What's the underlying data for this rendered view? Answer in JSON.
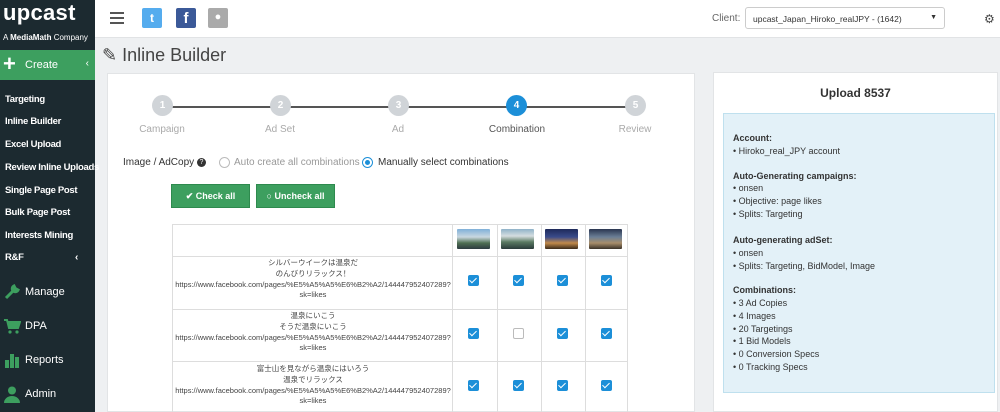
{
  "brand": {
    "logo": "upcast",
    "subtitle_prefix": "A ",
    "subtitle_brand": "MediaMath",
    "subtitle_suffix": " Company"
  },
  "sidebar": {
    "create_label": "Create",
    "sub_items": [
      {
        "label": "Targeting"
      },
      {
        "label": "Inline Builder"
      },
      {
        "label": "Excel Upload"
      },
      {
        "label": "Review Inline Uploads"
      },
      {
        "label": "Single Page Post"
      },
      {
        "label": "Bulk Page Post"
      },
      {
        "label": "Interests Mining"
      },
      {
        "label": "R&F"
      }
    ],
    "main_items": [
      {
        "label": "Manage",
        "icon": "wrench-icon"
      },
      {
        "label": "DPA",
        "icon": "cart-icon"
      },
      {
        "label": "Reports",
        "icon": "bar-chart-icon"
      },
      {
        "label": "Admin",
        "icon": "user-icon"
      }
    ]
  },
  "topbar": {
    "client_label": "Client:",
    "client_value": "upcast_Japan_Hiroko_realJPY - (1642)"
  },
  "page": {
    "title": "Inline Builder"
  },
  "steps": [
    {
      "num": "1",
      "label": "Campaign"
    },
    {
      "num": "2",
      "label": "Ad Set"
    },
    {
      "num": "3",
      "label": "Ad"
    },
    {
      "num": "4",
      "label": "Combination"
    },
    {
      "num": "5",
      "label": "Review"
    }
  ],
  "image_adcopy": {
    "label": "Image / AdCopy",
    "option_auto": "Auto create all combinations",
    "option_manual": "Manually select combinations",
    "check_all": "Check all",
    "uncheck_all": "Uncheck all"
  },
  "rows": [
    {
      "line1": "シルバーウイークは温泉だ",
      "line2": "のんびりリラックス！",
      "line3": "https://www.facebook.com/pages/%E5%A5%A5%E6%B2%A2/144447952407289?",
      "line4": "sk=likes",
      "checks": [
        true,
        true,
        true,
        true
      ]
    },
    {
      "line1": "温泉にいこう",
      "line2": "そうだ温泉にいこう",
      "line3": "https://www.facebook.com/pages/%E5%A5%A5%E6%B2%A2/144447952407289?",
      "line4": "sk=likes",
      "checks": [
        true,
        false,
        true,
        true
      ]
    },
    {
      "line1": "富士山を見ながら温泉にはいろう",
      "line2": "温泉でリラックス",
      "line3": "https://www.facebook.com/pages/%E5%A5%A5%E6%B2%A2/144447952407289?",
      "line4": "sk=likes",
      "checks": [
        true,
        true,
        true,
        true
      ]
    }
  ],
  "upload": {
    "title": "Upload 8537",
    "account_h": "Account:",
    "account_1": "• Hiroko_real_JPY account",
    "campaigns_h": "Auto-Generating campaigns:",
    "campaigns_1": "• onsen",
    "campaigns_2": "• Objective: page likes",
    "campaigns_3": "• Splits: Targeting",
    "adset_h": "Auto-generating adSet:",
    "adset_1": "• onsen",
    "adset_2": "• Splits: Targeting, BidModel, Image",
    "comb_h": "Combinations:",
    "comb_1": "• 3 Ad Copies",
    "comb_2": "• 4 Images",
    "comb_3": "• 20 Targetings",
    "comb_4": "• 1 Bid Models",
    "comb_5": "• 0 Conversion Specs",
    "comb_6": "• 0 Tracking Specs"
  }
}
